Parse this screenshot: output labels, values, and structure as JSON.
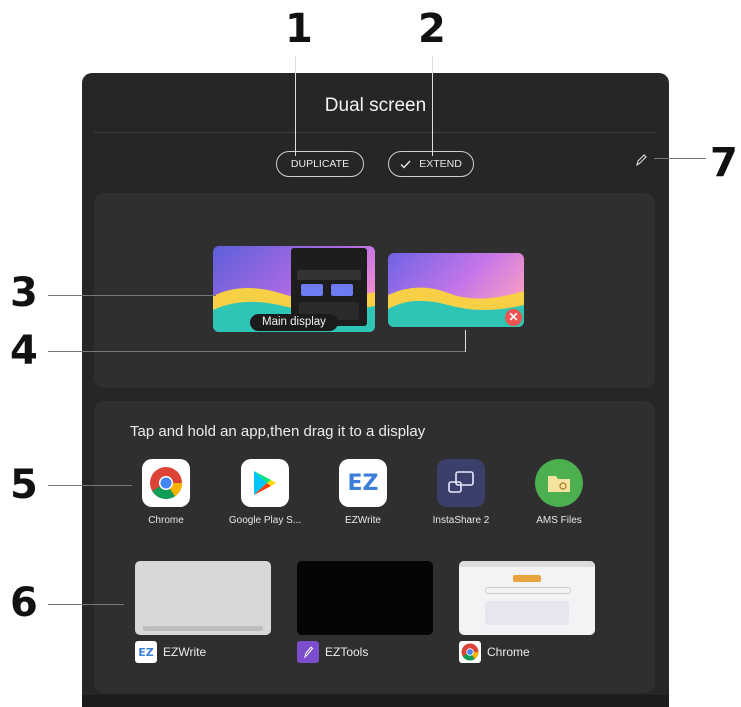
{
  "title": "Dual screen",
  "buttons": {
    "duplicate": "DUPLICATE",
    "extend": "EXTEND"
  },
  "displays": {
    "main_label": "Main display"
  },
  "hint": "Tap and hold an app,then drag it to a display",
  "apps": [
    {
      "label": "Chrome",
      "icon": "chrome-icon"
    },
    {
      "label": "Google Play S...",
      "icon": "google-play-icon"
    },
    {
      "label": "EZWrite",
      "icon": "ezwrite-icon"
    },
    {
      "label": "InstaShare 2",
      "icon": "instashare-icon"
    },
    {
      "label": "AMS Files",
      "icon": "ams-files-icon"
    }
  ],
  "recent": [
    {
      "label": "EZWrite",
      "icon": "ezwrite-icon"
    },
    {
      "label": "EZTools",
      "icon": "eztools-icon"
    },
    {
      "label": "Chrome",
      "icon": "chrome-icon"
    }
  ],
  "callouts": [
    "1",
    "2",
    "3",
    "4",
    "5",
    "6",
    "7"
  ],
  "colors": {
    "panel": "#262626",
    "card": "#2f2f2f",
    "close": "#ef5350"
  }
}
